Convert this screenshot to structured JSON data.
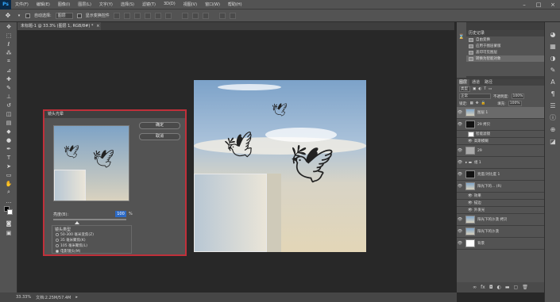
{
  "app": {
    "logo": "Ps"
  },
  "menubar": {
    "items": [
      "文件(F)",
      "编辑(E)",
      "图像(I)",
      "图层(L)",
      "文字(Y)",
      "选择(S)",
      "滤镜(T)",
      "3D(D)",
      "视图(V)",
      "窗口(W)",
      "帮助(H)"
    ],
    "window_controls": [
      "–",
      "□",
      "×"
    ]
  },
  "options_bar": {
    "auto_select_label": "自动选择:",
    "auto_select_value": "图层",
    "show_transform_label": "显示变换控件"
  },
  "document_tab": {
    "title": "未标题-1 @ 33.3% (图层 1, RGB/8#) *",
    "close": "×"
  },
  "statusbar": {
    "zoom": "33.33%",
    "doc_info": "文档:2.25M/57.4M"
  },
  "dialog": {
    "title": "镜头光晕",
    "ok_label": "确定",
    "cancel_label": "取消",
    "brightness_label": "亮度(B):",
    "brightness_value": "100",
    "brightness_unit": "%",
    "brightness_level": 0.33,
    "lens_type_label": "镜头类型",
    "lens_options": [
      {
        "label": "50-300 毫米变焦(Z)",
        "selected": false
      },
      {
        "label": "35 毫米聚焦(K)",
        "selected": false
      },
      {
        "label": "105 毫米聚焦(L)",
        "selected": false
      },
      {
        "label": "电影镜头(M)",
        "selected": true
      }
    ]
  },
  "history": {
    "tab": "历史记录",
    "items": [
      {
        "label": "自由变换",
        "selected": false
      },
      {
        "label": "应用于图层蒙版",
        "selected": false
      },
      {
        "label": "盖印可见图层",
        "selected": false
      },
      {
        "label": "转换为智能对象",
        "selected": true
      }
    ]
  },
  "layers_panel": {
    "tabs": [
      "图层",
      "通道",
      "路径"
    ],
    "filter_kind": "类型",
    "blend_mode": "正常",
    "opacity_label": "不透明度:",
    "opacity": "100%",
    "lock_label": "锁定:",
    "fill_label": "填充:",
    "fill": "100%",
    "layers": [
      {
        "name": "图层 1",
        "thumb": "sky",
        "selected": true
      },
      {
        "name": "29 拷贝",
        "thumb": "black",
        "selected": false
      },
      {
        "name": "智能滤镜",
        "thumb": "white",
        "selected": false,
        "sub": true
      },
      {
        "name": "高斯模糊",
        "thumb": "",
        "selected": false,
        "sub": true
      },
      {
        "name": "29",
        "thumb": "gray",
        "selected": false
      },
      {
        "name": "组 1",
        "thumb": "",
        "selected": false
      },
      {
        "name": "亮度/对比度 1",
        "thumb": "black",
        "selected": false
      },
      {
        "name": "阳光下的... (R)",
        "thumb": "sky",
        "selected": false
      },
      {
        "name": "效果",
        "thumb": "",
        "selected": false,
        "sub": true
      },
      {
        "name": "描边",
        "thumb": "",
        "selected": false,
        "sub": true
      },
      {
        "name": "外发光",
        "thumb": "",
        "selected": false,
        "sub": true
      },
      {
        "name": "阳光下的沙漠 拷贝",
        "thumb": "sky",
        "selected": false
      },
      {
        "name": "阳光下的沙漠",
        "thumb": "sky",
        "selected": false
      },
      {
        "name": "背景",
        "thumb": "white",
        "selected": false
      }
    ],
    "footer_icons": [
      "link-icon",
      "fx-icon",
      "mask-icon",
      "adjustment-icon",
      "folder-icon",
      "new-layer-icon",
      "trash-icon"
    ]
  }
}
